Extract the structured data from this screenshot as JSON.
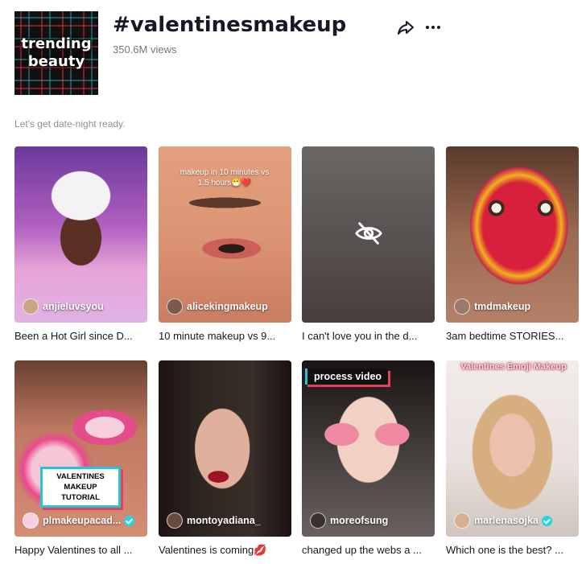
{
  "hashtag": {
    "cover_text_line1": "trending",
    "cover_text_line2": "beauty",
    "title": "#valentinesmakeup",
    "views": "350.6M views",
    "description": "Let's get date-night ready."
  },
  "icons": {
    "share": "share-icon",
    "more": "more-icon",
    "hidden": "eye-slash-icon",
    "verified": "verified-icon"
  },
  "colors": {
    "verified": "#20d5ec",
    "accent_cyan": "#25c4d8",
    "accent_red": "#e8405c"
  },
  "videos": [
    {
      "author": "anjieluvsyou",
      "verified": false,
      "caption": "Been a Hot Girl since D...",
      "overlay": ""
    },
    {
      "author": "alicekingmakeup",
      "verified": false,
      "caption": "10 minute makeup vs 9...",
      "overlay": "makeup in 10 minutes vs 1.5 hours😷❤️"
    },
    {
      "author": "",
      "verified": false,
      "caption": "I can't love you in the d...",
      "overlay": ""
    },
    {
      "author": "tmdmakeup",
      "verified": false,
      "caption": "3am bedtime STORIES...",
      "overlay": ""
    },
    {
      "author": "plmakeupacad...",
      "verified": true,
      "caption": "Happy Valentines to all ...",
      "overlay": "VALENTINES MAKEUP TUTORIAL"
    },
    {
      "author": "montoyadiana_",
      "verified": false,
      "caption": "Valentines is coming💋",
      "overlay": ""
    },
    {
      "author": "moreofsung",
      "verified": false,
      "caption": "changed up the webs a ...",
      "overlay": "process video"
    },
    {
      "author": "marlenasojka",
      "verified": true,
      "caption": "Which one is the best? ...",
      "overlay": "Valentines Emoji Makeup"
    }
  ]
}
